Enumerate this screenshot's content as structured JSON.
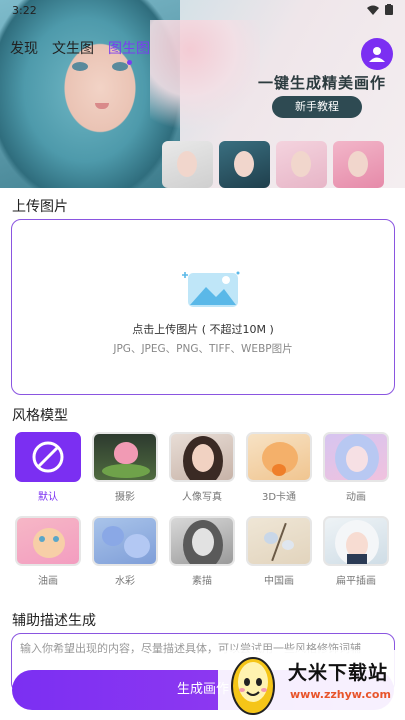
{
  "status_bar": {
    "time": "3:22",
    "icons": [
      "wifi-icon",
      "battery-icon"
    ]
  },
  "header": {
    "tabs": [
      {
        "label": "发现",
        "active": false
      },
      {
        "label": "文生图",
        "active": false
      },
      {
        "label": "图生图",
        "active": true
      }
    ],
    "avatar_icon": "user-icon"
  },
  "banner": {
    "slogan": "一键生成精美画作",
    "tutorial_label": "新手教程"
  },
  "upload": {
    "section_title": "上传图片",
    "main_text": "点击上传图片 ( 不超过10M )",
    "formats_text": "JPG、JPEG、PNG、TIFF、WEBP图片",
    "icon": "image-upload-icon"
  },
  "styles": {
    "section_title": "风格模型",
    "items": [
      {
        "label": "默认",
        "selected": true
      },
      {
        "label": "摄影",
        "selected": false
      },
      {
        "label": "人像写真",
        "selected": false
      },
      {
        "label": "3D卡通",
        "selected": false
      },
      {
        "label": "动画",
        "selected": false
      },
      {
        "label": "油画",
        "selected": false
      },
      {
        "label": "水彩",
        "selected": false
      },
      {
        "label": "素描",
        "selected": false
      },
      {
        "label": "中国画",
        "selected": false
      },
      {
        "label": "扁平插画",
        "selected": false
      }
    ]
  },
  "description": {
    "section_title": "辅助描述生成",
    "placeholder": "输入你希望出现的内容，尽量描述具体，可以尝试用一些风格修饰词辅"
  },
  "generate": {
    "label": "生成画作"
  },
  "watermark": {
    "name": "大米下载站",
    "url": "www.zzhyw.com"
  },
  "colors": {
    "accent": "#7b2ff2",
    "tutorial_bg": "#2e4a52",
    "watermark_url": "#e8542b"
  }
}
